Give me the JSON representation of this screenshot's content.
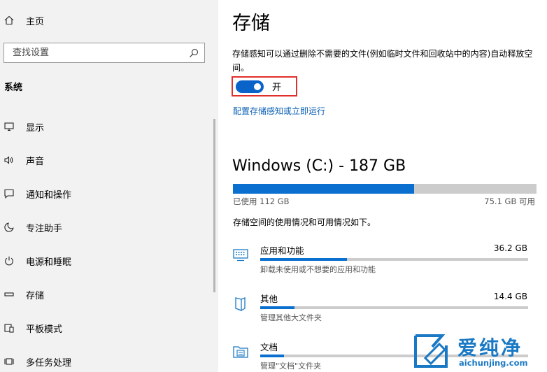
{
  "sidebar": {
    "home_label": "主页",
    "search_placeholder": "查找设置",
    "section_title": "系统",
    "items": [
      {
        "label": "显示",
        "icon": "monitor-icon"
      },
      {
        "label": "声音",
        "icon": "speaker-icon"
      },
      {
        "label": "通知和操作",
        "icon": "notification-icon"
      },
      {
        "label": "专注助手",
        "icon": "moon-icon"
      },
      {
        "label": "电源和睡眠",
        "icon": "power-icon"
      },
      {
        "label": "存储",
        "icon": "storage-icon"
      },
      {
        "label": "平板模式",
        "icon": "tablet-icon"
      },
      {
        "label": "多任务处理",
        "icon": "multitask-icon"
      }
    ]
  },
  "main": {
    "title": "存储",
    "storage_sense_desc": "存储感知可以通过删除不需要的文件(例如临时文件和回收站中的内容)自动释放空间。",
    "toggle_state": "开",
    "toggle_on": true,
    "config_link": "配置存储感知或立即运行",
    "drive": {
      "title": "Windows (C:) - 187 GB",
      "used_label": "已使用 112 GB",
      "free_label": "75.1 GB 可用",
      "used_fraction": 0.597
    },
    "usage_note": "存储空间的使用情况和可用情况如下。",
    "categories": [
      {
        "name": "应用和功能",
        "size": "36.2 GB",
        "desc": "卸载未使用或不想要的应用和功能",
        "fraction": 0.323,
        "icon": "apps-icon"
      },
      {
        "name": "其他",
        "size": "14.4 GB",
        "desc": "管理其他大文件夹",
        "fraction": 0.129,
        "icon": "other-files-icon"
      },
      {
        "name": "文档",
        "size": "",
        "desc": "管理\"文档\"文件夹",
        "fraction": 0.09,
        "icon": "documents-folder-icon"
      }
    ]
  },
  "watermark": {
    "text": "爱纯净",
    "url": "aichunjing.com"
  },
  "colors": {
    "accent": "#0a6fce",
    "toggle_on": "#0a63c8",
    "highlight_border": "#e0302c",
    "link": "#0a5fb5",
    "sidebar_bg": "#f2f2f2"
  }
}
